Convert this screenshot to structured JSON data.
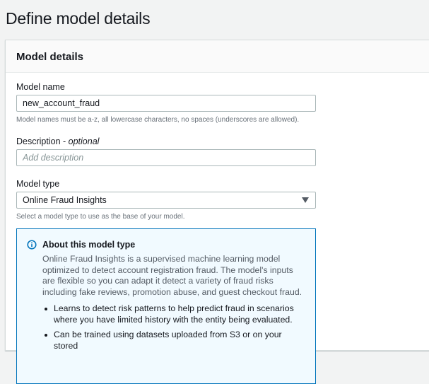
{
  "page": {
    "title": "Define model details"
  },
  "panel": {
    "title": "Model details"
  },
  "model_name": {
    "label": "Model name",
    "value": "new_account_fraud",
    "hint": "Model names must be a-z, all lowercase characters, no spaces (underscores are allowed)."
  },
  "description": {
    "label": "Description - ",
    "optional": "optional",
    "placeholder": "Add description"
  },
  "model_type": {
    "label": "Model type",
    "selected": "Online Fraud Insights",
    "hint": "Select a model type to use as the base of your model."
  },
  "info": {
    "title": "About this model type",
    "text": "Online Fraud Insights is a supervised machine learning model optimized to detect account registration fraud. The model's inputs are flexible so you can adapt it detect a variety of fraud risks including fake reviews, promotion abuse, and guest checkout fraud.",
    "bullets": [
      "Learns to detect risk patterns to help predict fraud in scenarios where you have limited history with the entity being evaluated.",
      "Can be trained using datasets uploaded from S3 or on your stored"
    ],
    "icon": "info-icon",
    "accent": "#0073bb"
  }
}
